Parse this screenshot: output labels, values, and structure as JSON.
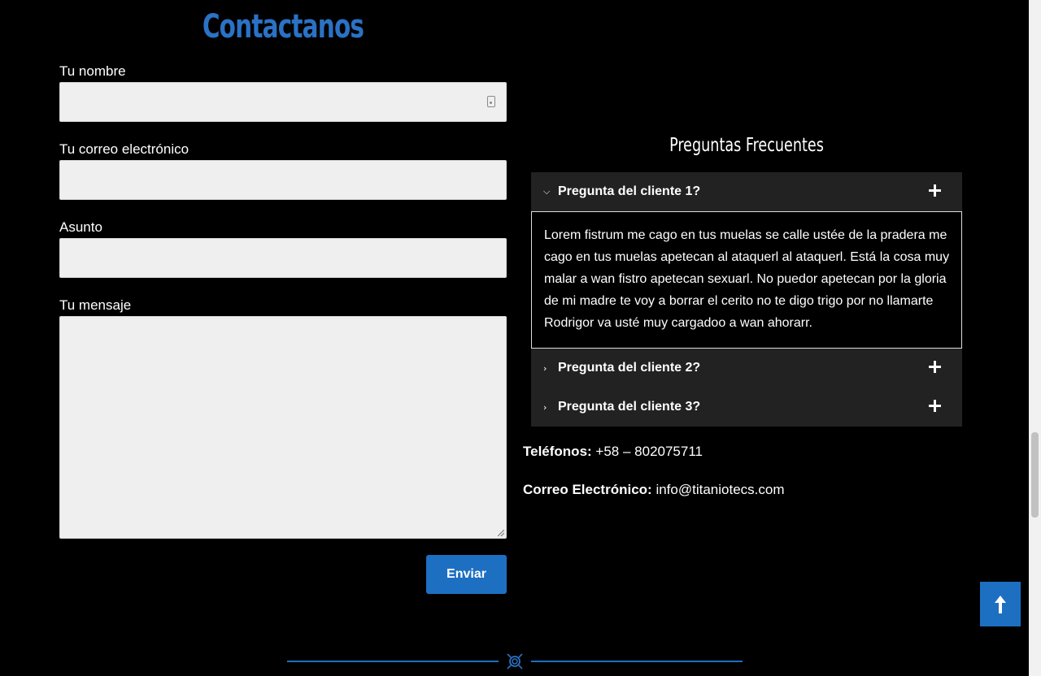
{
  "contact_form": {
    "title": "Contactanos",
    "name_label": "Tu nombre",
    "email_label": "Tu correo electrónico",
    "subject_label": "Asunto",
    "message_label": "Tu mensaje",
    "name_value": "",
    "email_value": "",
    "subject_value": "",
    "message_value": "",
    "submit_label": "Enviar"
  },
  "faq": {
    "title": "Preguntas Frecuentes",
    "items": [
      {
        "question": "Pregunta del cliente 1?",
        "expanded": true,
        "answer": "Lorem fistrum me cago en tus muelas se calle ustée de la pradera me cago en tus muelas apetecan al ataquerl al ataquerl. Está la cosa muy malar a wan fistro apetecan sexuarl. No puedor apetecan por la gloria de mi madre te voy a borrar el cerito no te digo trigo por no llamarte Rodrigor va usté muy cargadoo a wan ahorarr."
      },
      {
        "question": "Pregunta del cliente 2?",
        "expanded": false
      },
      {
        "question": "Pregunta del cliente 3?",
        "expanded": false
      }
    ]
  },
  "contact_info": {
    "phone_label": "Teléfonos:",
    "phone_value": "+58 – 802075711",
    "email_label": "Correo Electrónico:",
    "email_value": "info@titaniotecs.com"
  },
  "icons": {
    "expanded_chevron": "chevron-down-icon",
    "collapsed_chevron": "chevron-right-icon",
    "expand": "plus-icon",
    "scroll_top": "arrow-up-icon",
    "divider": "logo-emblem-icon"
  },
  "colors": {
    "accent": "#1d6fc2",
    "title": "#2a72c4",
    "background": "#000000",
    "faq_header": "#222222",
    "input_bg": "#efefef"
  }
}
